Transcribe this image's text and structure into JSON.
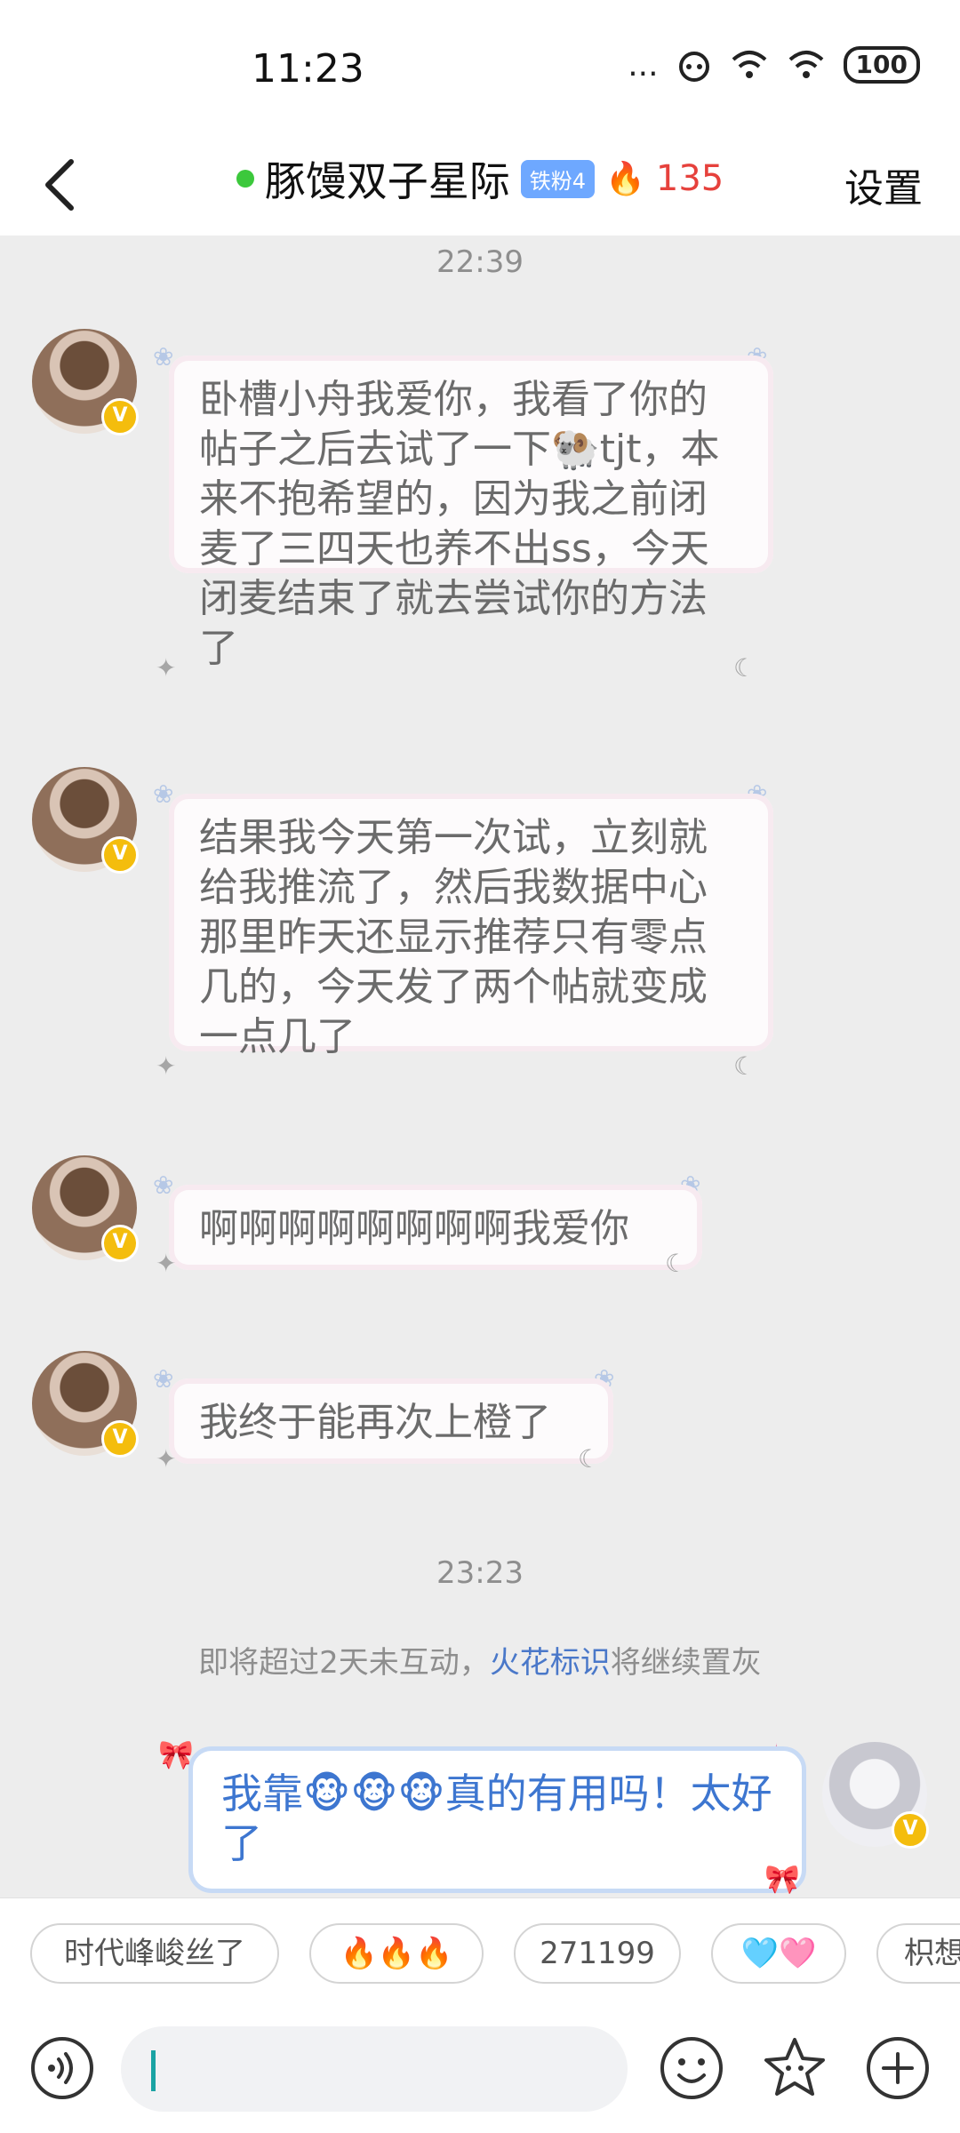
{
  "status_bar": {
    "time": "11:23",
    "signal": "...",
    "battery": "100"
  },
  "header": {
    "title": "豚馒双子星际",
    "badge": "铁粉4",
    "fire_count": "135",
    "settings_label": "设置"
  },
  "chat": {
    "time_1": "22:39",
    "messages": [
      {
        "text": "卧槽小舟我爱你，我看了你的帖子之后去试了一下🐏tjt，本来不抱希望的，因为我之前闭麦了三四天也养不出ss，今天闭麦结束了就去尝试你的方法了"
      },
      {
        "text": "结果我今天第一次试，立刻就给我推流了，然后我数据中心那里昨天还显示推荐只有零点几的，今天发了两个帖就变成一点几了"
      },
      {
        "text": "啊啊啊啊啊啊啊啊我爱你"
      },
      {
        "text": "我终于能再次上橙了"
      }
    ],
    "time_2": "23:23",
    "notice_prefix": "即将超过2天未互动，",
    "notice_link": "火花标识",
    "notice_suffix": "将继续置灰",
    "my_message": "我靠🐵🐵🐵真的有用吗！太好了"
  },
  "quick_replies": [
    "时代峰峻丝了",
    "🔥🔥🔥",
    "271199",
    "🩵🩷",
    "枳想"
  ],
  "input": {
    "value": "",
    "placeholder": ""
  },
  "icons": {
    "back": "back-arrow-icon",
    "voice": "voice-icon",
    "emoji": "emoji-icon",
    "sticker": "star-sticker-icon",
    "add": "plus-icon"
  },
  "colors": {
    "accent": "#3d76d0",
    "fire": "#e6413c",
    "online": "#3cc83c",
    "verified": "#f4bd0d"
  }
}
